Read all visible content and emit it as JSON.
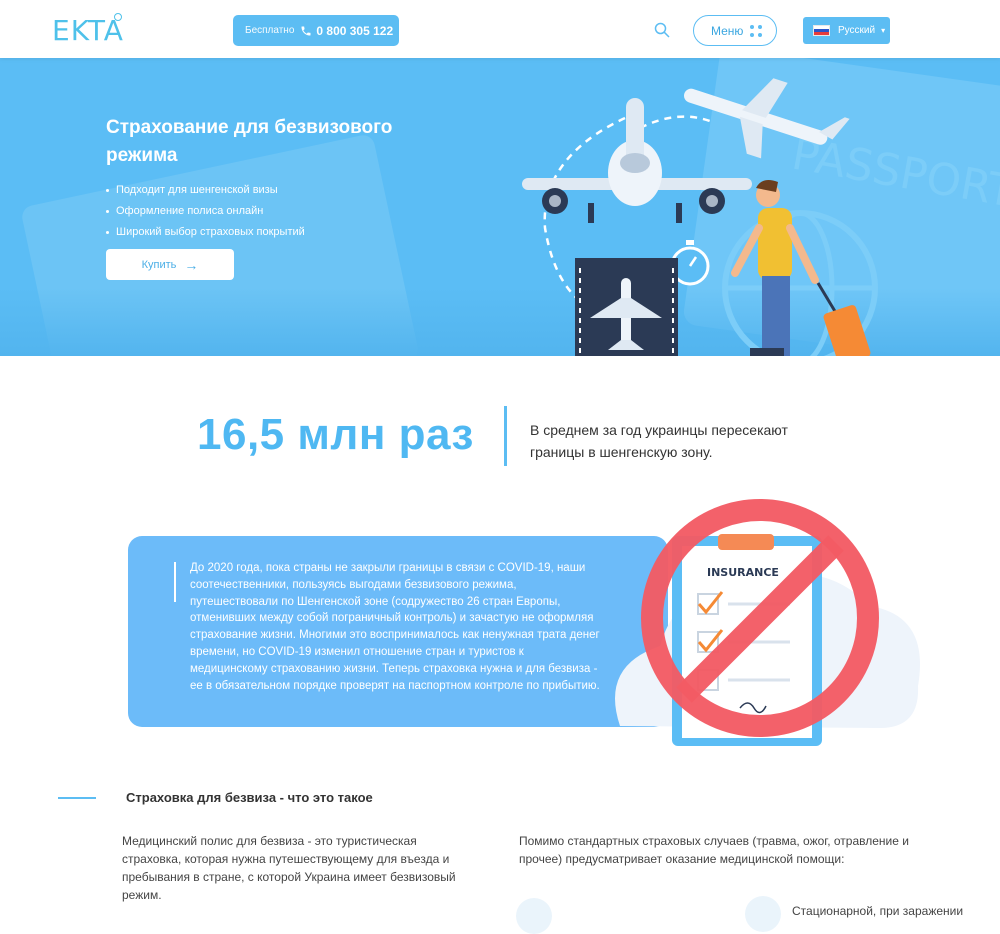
{
  "header": {
    "logo": "EKTA",
    "phone_free": "Бесплатно",
    "phone_number": "0 800 305 122",
    "menu_label": "Меню",
    "language": "Русский",
    "icons": [
      "search-icon",
      "phone-icon",
      "menu-dots-icon",
      "flag-ru-icon",
      "chevron-down-icon"
    ]
  },
  "hero": {
    "title": "Страхование для безвизового режима",
    "bullets": [
      "Подходит для шенгенской визы",
      "Оформление полиса онлайн",
      "Широкий выбор страховых покрытий"
    ],
    "buy_label": "Купить",
    "passport_text": "PASSPORT"
  },
  "stat": {
    "number": "16,5 млн раз",
    "text": "В среднем за год украинцы пересекают границы в шенгенскую зону."
  },
  "card": {
    "text": "До 2020 года, пока страны не закрыли границы в связи с COVID-19, наши соотечественники, пользуясь выгодами безвизового режима, путешествовали по Шенгенской зоне (содружество 26 стран Европы, отменивших между собой пограничный контроль) и зачастую не оформляя страхование жизни. Многими это воспринималось как ненужная трата денег времени, но COVID-19 изменил отношение стран и туристов к медицинскому страхованию жизни. Теперь страховка нужна и для безвиза - ее в обязательном порядке проверят на паспортном контроле по прибытию.",
    "insurance_label": "INSURANCE"
  },
  "section": {
    "title": "Страховка для безвиза - что это такое",
    "col1": "Медицинский полис для безвиза - это туристическая страховка, которая нужна путешествующему для въезда и пребывания в стране, с которой Украина имеет безвизовый режим.",
    "col2": "Помимо стандартных страховых случаев (травма, ожог, отравление и прочее) предусматривает оказание медицинской помощи:",
    "cut_item": "Стационарной, при заражении"
  },
  "colors": {
    "accent": "#5cbdf3",
    "hero_bg": "#5bbdf5",
    "stat": "#4fb8f2",
    "card_bg": "#6cbbf9",
    "forbidden_red": "#f35b64"
  }
}
